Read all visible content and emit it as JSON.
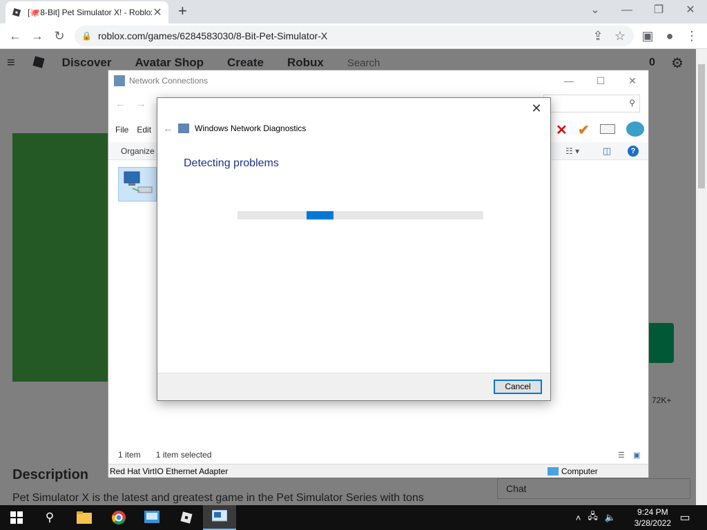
{
  "browser": {
    "tab_title": "[🐙8-Bit] Pet Simulator X! - Roblox",
    "tab_close": "✕",
    "new_tab": "+",
    "url": "roblox.com/games/6284583030/8-Bit-Pet-Simulator-X",
    "window_controls": {
      "minimize": "—",
      "restore": "❐",
      "close": "✕",
      "tab_search": "⌄"
    }
  },
  "roblox": {
    "nav": [
      "Discover",
      "Avatar Shop",
      "Create",
      "Robux"
    ],
    "search_placeholder": "Search",
    "robux_count": "0",
    "description_title": "Description",
    "description_text": "Pet Simulator X is the latest and greatest game in the Pet Simulator Series with tons",
    "chat_label": "Chat",
    "votes": "72K+"
  },
  "network_window": {
    "title": "Network Connections",
    "menu": [
      "File",
      "Edit"
    ],
    "organize": "Organize",
    "status_items": "1 item",
    "status_selected": "1 item selected",
    "adapter_name": "Red Hat VirtIO Ethernet Adapter",
    "location": "Computer"
  },
  "diagnostics": {
    "title": "Windows Network Diagnostics",
    "heading": "Detecting problems",
    "progress_start": 0.28,
    "progress_length": 0.11,
    "cancel_label": "Cancel"
  },
  "taskbar": {
    "time": "9:24 PM",
    "date": "3/28/2022"
  },
  "colors": {
    "accent": "#0078d7",
    "heading": "#1e3287",
    "taskbar": "#101010"
  }
}
